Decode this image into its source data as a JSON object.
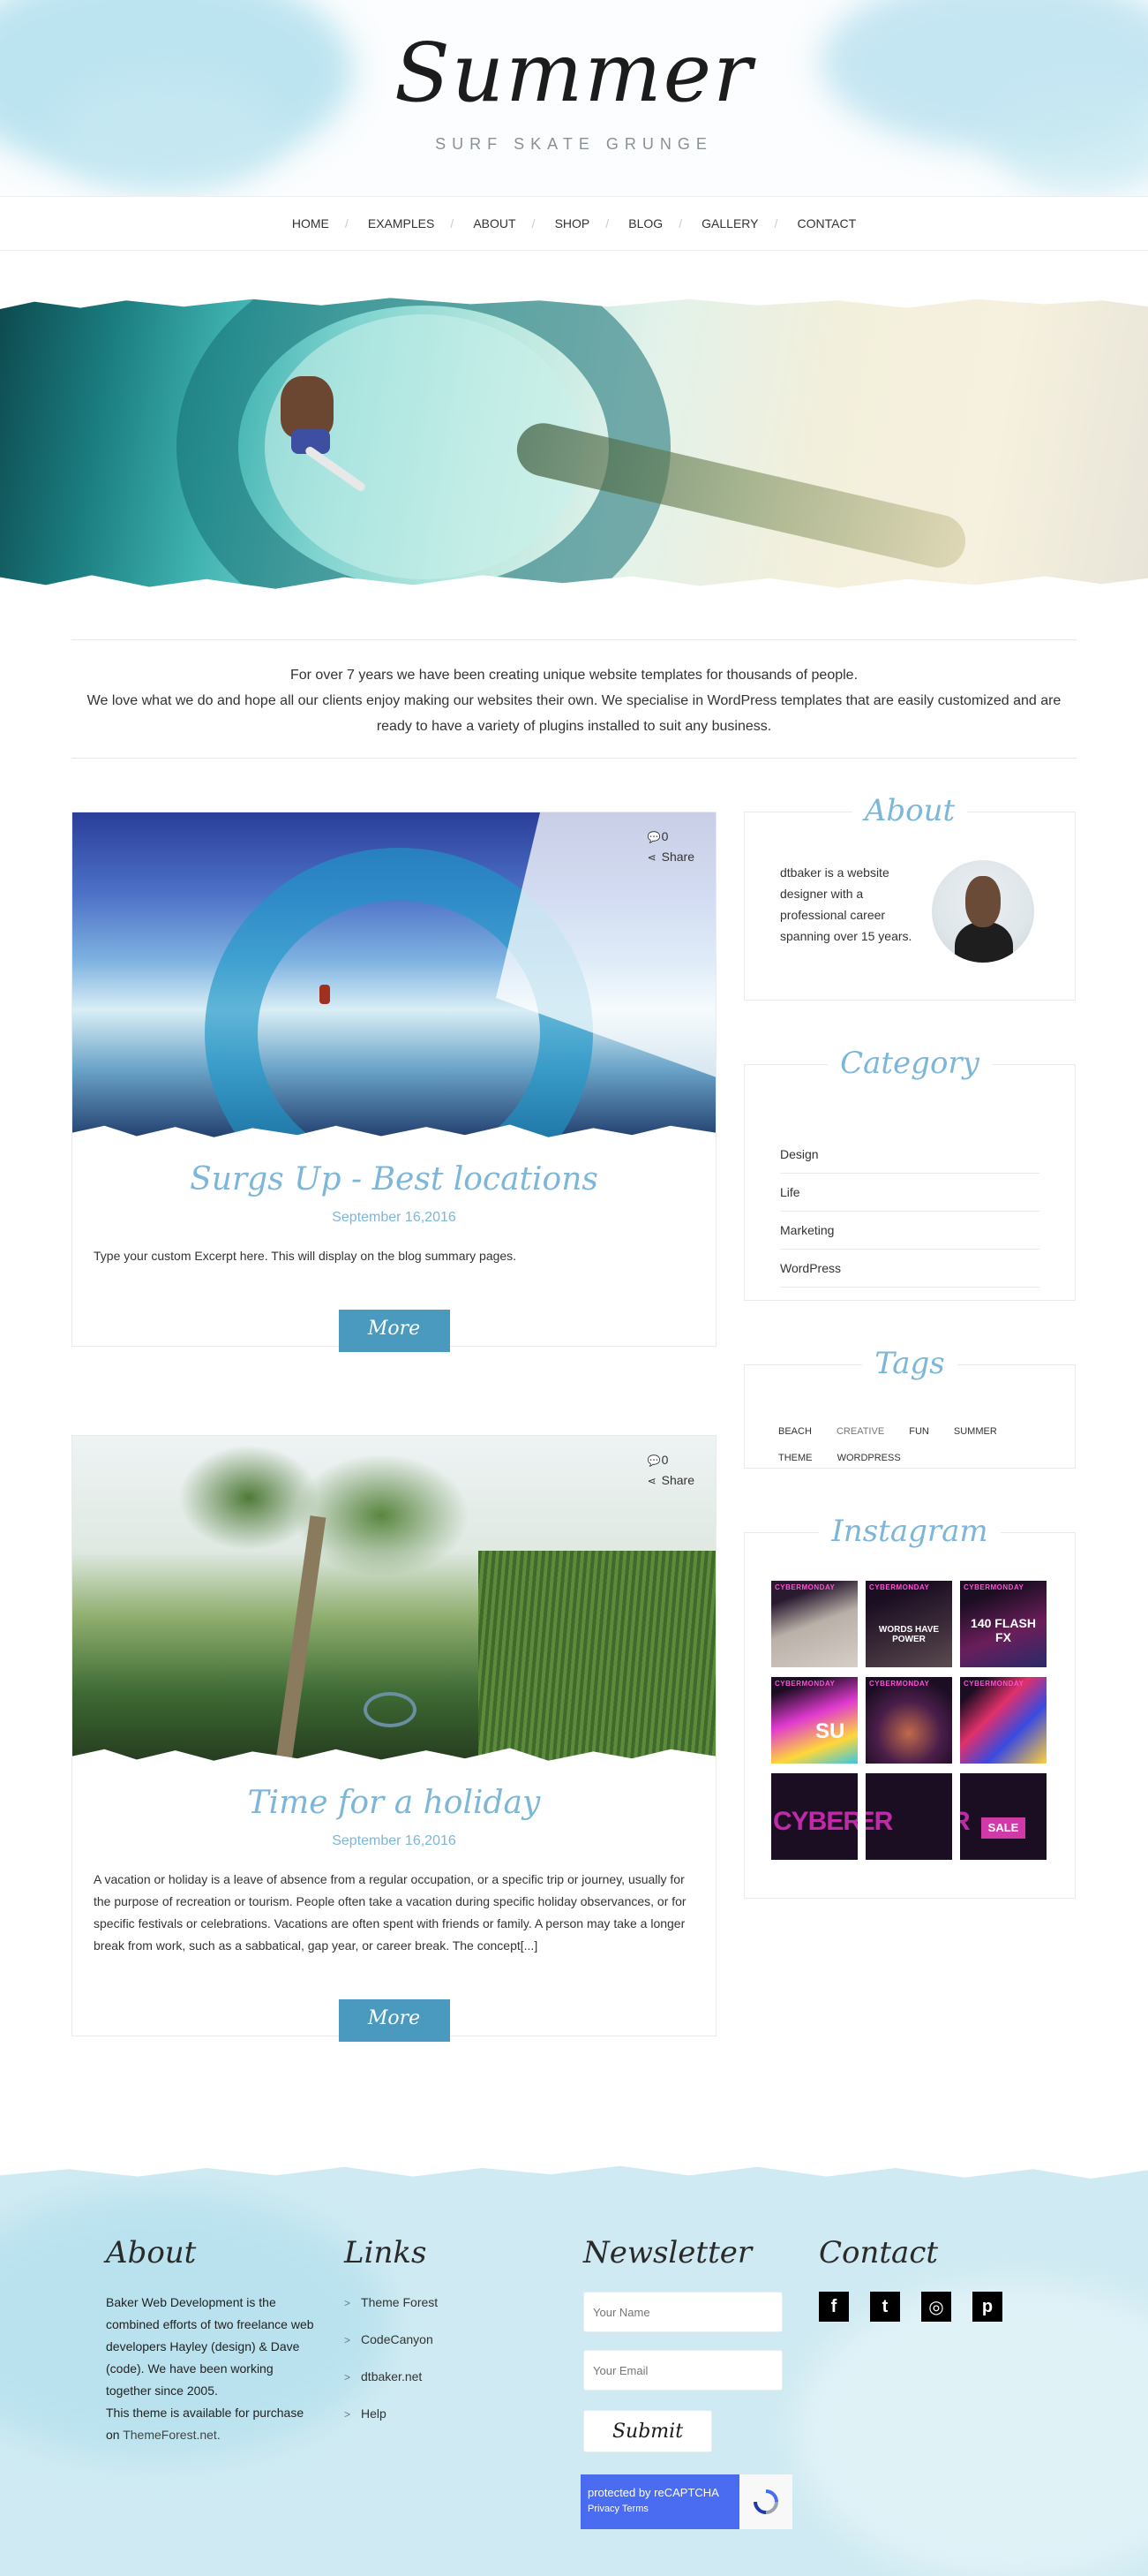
{
  "header": {
    "logo": "Summer",
    "tagline": "SURF SKATE GRUNGE"
  },
  "nav": {
    "items": [
      "HOME",
      "EXAMPLES",
      "ABOUT",
      "SHOP",
      "BLOG",
      "GALLERY",
      "CONTACT"
    ]
  },
  "intro": {
    "line1": "For over 7 years we have been creating unique website templates for thousands of people.",
    "line2": "We love what we do and hope all our clients enjoy making our websites their own. We specialise in WordPress templates that are easily customized and are ready to have a variety of plugins installed to suit any business."
  },
  "posts": [
    {
      "comments": "0",
      "share_label": "Share",
      "title": "Surgs Up - Best locations",
      "date": "September 16,2016",
      "excerpt": "Type your custom Excerpt here. This will display on the blog summary pages.",
      "more_label": "More"
    },
    {
      "comments": "0",
      "share_label": "Share",
      "title": "Time for a holiday",
      "date": "September 16,2016",
      "excerpt": "A vacation or holiday is a leave of absence from a regular occupation, or a specific trip or journey, usually for the purpose of recreation or tourism. People often take a vacation during specific holiday observances, or for specific festivals or celebrations. Vacations are often spent with friends or family. A person may take a longer break from work, such as a sabbatical, gap year, or career break. The concept[...]",
      "more_label": "More"
    }
  ],
  "sidebar": {
    "about": {
      "title": "About",
      "text": "dtbaker is a website designer with a professional career spanning over 15 years."
    },
    "category": {
      "title": "Category",
      "items": [
        "Design",
        "Life",
        "Marketing",
        "WordPress"
      ]
    },
    "tags": {
      "title": "Tags",
      "items": [
        "BEACH",
        "CREATIVE",
        "FUN",
        "SUMMER",
        "THEME",
        "WORDPRESS"
      ]
    },
    "instagram": {
      "title": "Instagram",
      "header_text": "CYBERMONDAY",
      "tiles": [
        "",
        "WORDS HAVE POWER",
        "140 FLASH FX",
        "SU",
        "",
        "",
        "CYBER",
        "",
        "SALE"
      ]
    }
  },
  "footer": {
    "about": {
      "title": "About",
      "text": "Baker Web Development is the combined efforts of two freelance web developers Hayley (design) & Dave (code). We have been working together since 2005.",
      "text2": "This theme is available for purchase on",
      "link": "ThemeForest.net."
    },
    "links": {
      "title": "Links",
      "items": [
        "Theme Forest",
        "CodeCanyon",
        "dtbaker.net",
        "Help"
      ]
    },
    "newsletter": {
      "title": "Newsletter",
      "name_placeholder": "Your Name",
      "email_placeholder": "Your Email",
      "submit_label": "Submit",
      "captcha_text": "protected by reCAPTCHA",
      "captcha_links": "Privacy  Terms"
    },
    "contact": {
      "title": "Contact",
      "social": [
        "f",
        "t",
        "◎",
        "p"
      ]
    }
  }
}
